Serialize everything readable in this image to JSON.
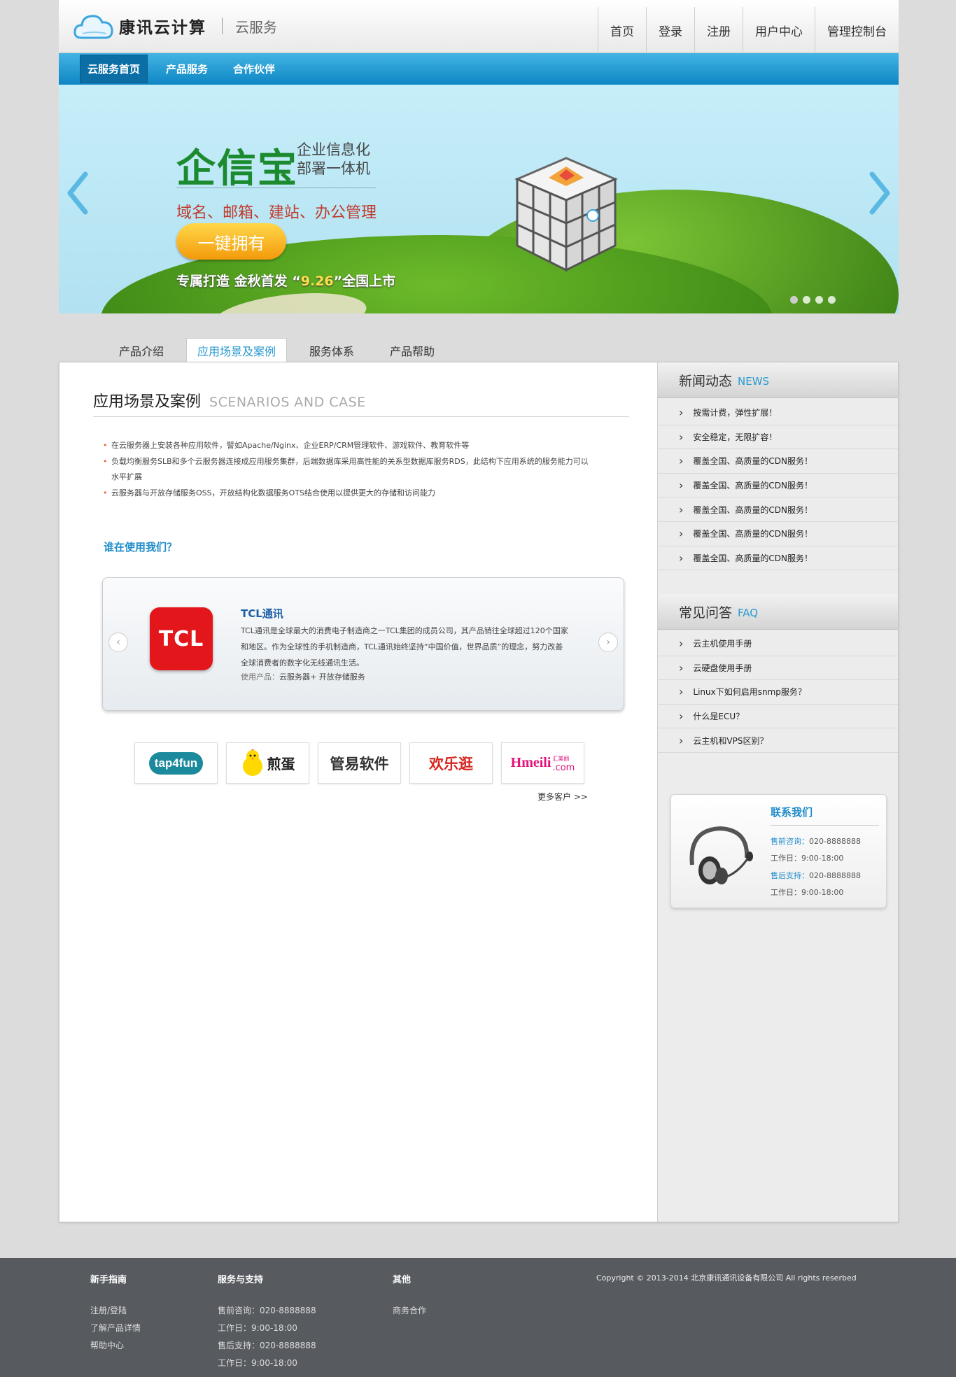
{
  "header": {
    "logo_text": "康讯云计算",
    "logo_sub": "云服务",
    "nav": [
      "首页",
      "登录",
      "注册",
      "用户中心",
      "管理控制台"
    ]
  },
  "bluenav": [
    "云服务首页",
    "产品服务",
    "合作伙伴"
  ],
  "banner": {
    "title": "企信宝",
    "title_side": "企业信息化部署一体机",
    "subtitle": "域名、邮箱、建站、办公管理",
    "button": "一键拥有",
    "foot_a": "专属打造  金秋首发  “",
    "foot_date": "9.26",
    "foot_b": "”全国上市",
    "slides": 4,
    "active_slide": 0
  },
  "tabs": [
    "产品介绍",
    "应用场景及案例",
    "服务体系",
    "产品帮助"
  ],
  "section": {
    "title": "应用场景及案例",
    "title_en": "SCENARIOS AND CASE",
    "bullets": [
      "在云服务器上安装各种应用软件，譬如Apache/Nginx、企业ERP/CRM管理软件、游戏软件、教育软件等",
      "负载均衡服务SLB和多个云服务器连接成应用服务集群，后端数据库采用高性能的关系型数据库服务RDS，此结构下应用系统的服务能力可以水平扩展",
      "云服务器与开放存储服务OSS，开放结构化数据服务OTS结合使用以提供更大的存储和访问能力"
    ],
    "who": "谁在使用我们？"
  },
  "case": {
    "logo": "TCL",
    "name": "TCL通讯",
    "desc": "TCL通讯是全球最大的消费电子制造商之一TCL集团的成员公司，其产品销往全球超过120个国家和地区。作为全球性的手机制造商，TCL通讯始终坚持“中国价值，世界品质”的理念，努力改善全球消费者的数字化无线通讯生活。",
    "prod_label": "使用产品：",
    "prod_value": "云服务器+ 开放存储服务"
  },
  "clients": [
    "tap4fun",
    "煎蛋",
    "管易软件",
    "欢乐逛",
    "Hmeili"
  ],
  "clients_extra": {
    "jiandan_prefix": "",
    "hmeili_cn": "汇美丽",
    "hmeili_com": ".com"
  },
  "more": "更多客户 >>",
  "news": {
    "title": "新闻动态",
    "title_en": "NEWS",
    "items": [
      "按需计费，弹性扩展！",
      "安全稳定，无限扩容！",
      "覆盖全国、高质量的CDN服务！",
      "覆盖全国、高质量的CDN服务！",
      "覆盖全国、高质量的CDN服务！",
      "覆盖全国、高质量的CDN服务！",
      "覆盖全国、高质量的CDN服务！"
    ]
  },
  "faq": {
    "title": "常见问答",
    "title_en": "FAQ",
    "items": [
      "云主机使用手册",
      "云硬盘使用手册",
      "Linux下如何启用snmp服务？",
      "什么是ECU？",
      "云主机和VPS区别？"
    ]
  },
  "contact": {
    "title": "联系我们",
    "pre_label": "售前咨询：",
    "pre_phone": "020-8888888",
    "pre_hours": "工作日：9:00-18:00",
    "post_label": "售后支持：",
    "post_phone": "020-8888888",
    "post_hours": "工作日：9:00-18:00"
  },
  "footer": {
    "guide": {
      "title": "新手指南",
      "links": [
        "注册/登陆",
        "了解产品详情",
        "帮助中心"
      ]
    },
    "support": {
      "title": "服务与支持",
      "links": [
        "售前咨询：020-8888888",
        "工作日：9:00-18:00",
        "售后支持：020-8888888",
        "工作日：9:00-18:00"
      ]
    },
    "other": {
      "title": "其他",
      "links": [
        "商务合作"
      ]
    },
    "copyright": "Copyright © 2013-2014  北京康讯通讯设备有限公司   All rights reserbed"
  },
  "colors": {
    "accent": "#1f8cc9",
    "nav_blue": "#0e86c4",
    "footer": "#575a5f",
    "tcl_red": "#e3171b"
  }
}
